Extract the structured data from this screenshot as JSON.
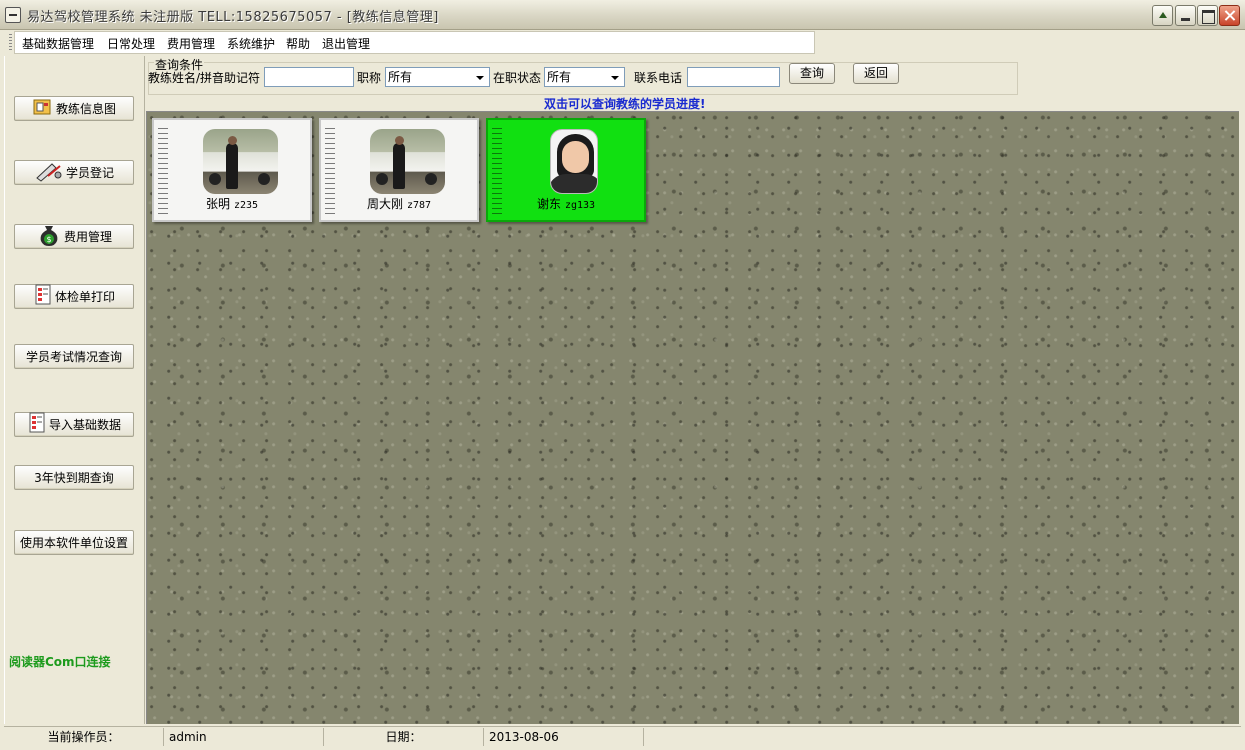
{
  "window": {
    "title": "易达驾校管理系统 未注册版 TELL:15825675057 - [教练信息管理]"
  },
  "menu": [
    "基础数据管理",
    "日常处理",
    "费用管理",
    "系统维护",
    "帮助",
    "退出管理"
  ],
  "sidebar": {
    "buttons": [
      {
        "label": "教练信息图",
        "icon": "folder-cards-icon"
      },
      {
        "label": "学员登记",
        "icon": "pen-register-icon"
      },
      {
        "label": "费用管理",
        "icon": "money-bag-icon"
      },
      {
        "label": "体检单打印",
        "icon": "document-icon"
      },
      {
        "label": "学员考试情况查询",
        "icon": ""
      },
      {
        "label": "导入基础数据",
        "icon": "document-icon"
      },
      {
        "label": "3年快到期查询",
        "icon": ""
      },
      {
        "label": "使用本软件单位设置",
        "icon": ""
      }
    ],
    "com_status": "阅读器Com口连接"
  },
  "query": {
    "group_title": "查询条件",
    "name_label": "教练姓名/拼音助记符",
    "name_value": "",
    "title_label": "职称",
    "title_value": "所有",
    "status_label": "在职状态",
    "status_value": "所有",
    "phone_label": "联系电话",
    "phone_value": "",
    "search_button": "查询",
    "back_button": "返回",
    "hint": "双击可以查询教练的学员进度!"
  },
  "coaches": [
    {
      "name": "张明",
      "code": "z235",
      "photo": "car-photo",
      "selected": false
    },
    {
      "name": "周大刚",
      "code": "z787",
      "photo": "car-photo",
      "selected": false
    },
    {
      "name": "谢东",
      "code": "zg133",
      "photo": "portrait-photo",
      "selected": true
    }
  ],
  "statusbar": {
    "operator_label": "当前操作员：",
    "operator_value": "admin",
    "date_label": "日期：",
    "date_value": "2013-08-06"
  },
  "colors": {
    "selected_card": "#11e011",
    "hint_text": "#1a2bd0",
    "com_status_text": "#1d9b1d"
  }
}
